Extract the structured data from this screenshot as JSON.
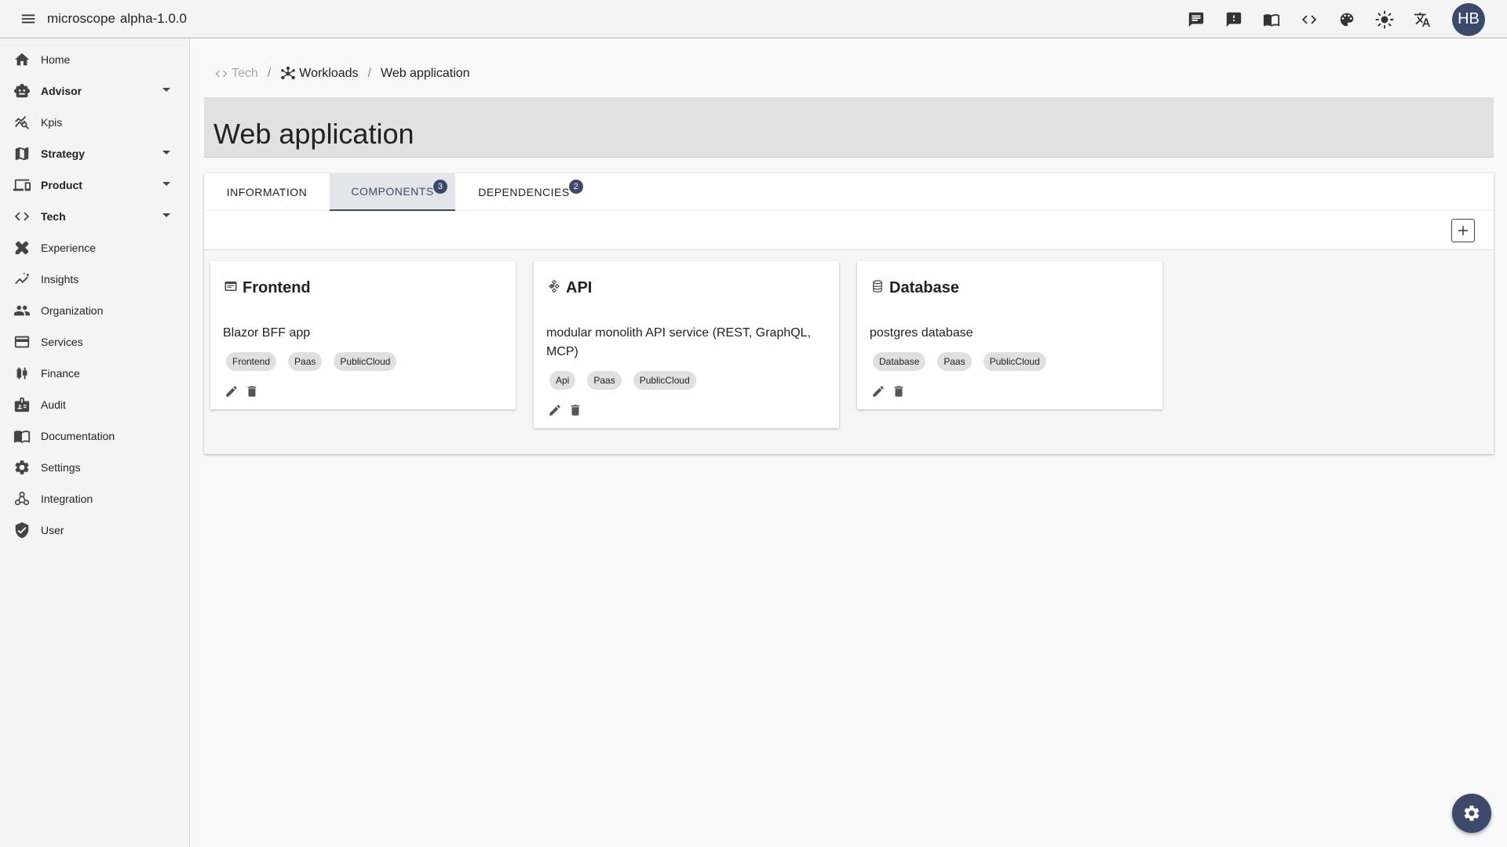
{
  "appbar": {
    "title": "microscope",
    "version": "alpha-1.0.0",
    "avatar_initials": "HB",
    "actions": [
      "chat-icon",
      "feedback-icon",
      "docs-book-icon",
      "code-icon",
      "palette-icon",
      "brightness-icon",
      "translate-icon"
    ]
  },
  "sidebar": {
    "items": [
      {
        "label": "Home",
        "icon": "home-icon",
        "bold": false,
        "expandable": false
      },
      {
        "label": "Advisor",
        "icon": "robot-icon",
        "bold": true,
        "expandable": true
      },
      {
        "label": "Kpis",
        "icon": "query-stats-icon",
        "bold": false,
        "expandable": false
      },
      {
        "label": "Strategy",
        "icon": "map-icon",
        "bold": true,
        "expandable": true
      },
      {
        "label": "Product",
        "icon": "devices-icon",
        "bold": true,
        "expandable": true
      },
      {
        "label": "Tech",
        "icon": "code-icon",
        "bold": true,
        "expandable": true
      },
      {
        "label": "Experience",
        "icon": "design-icon",
        "bold": false,
        "expandable": false
      },
      {
        "label": "Insights",
        "icon": "insights-icon",
        "bold": false,
        "expandable": false
      },
      {
        "label": "Organization",
        "icon": "people-icon",
        "bold": false,
        "expandable": false
      },
      {
        "label": "Services",
        "icon": "card-icon",
        "bold": false,
        "expandable": false
      },
      {
        "label": "Finance",
        "icon": "candlestick-icon",
        "bold": false,
        "expandable": false
      },
      {
        "label": "Audit",
        "icon": "audit-icon",
        "bold": false,
        "expandable": false
      },
      {
        "label": "Documentation",
        "icon": "book-icon",
        "bold": false,
        "expandable": false
      },
      {
        "label": "Settings",
        "icon": "gear-icon",
        "bold": false,
        "expandable": false
      },
      {
        "label": "Integration",
        "icon": "webhook-icon",
        "bold": false,
        "expandable": false
      },
      {
        "label": "User",
        "icon": "shield-icon",
        "bold": false,
        "expandable": false
      }
    ]
  },
  "breadcrumb": {
    "tech": "Tech",
    "workloads": "Workloads",
    "current": "Web application"
  },
  "page": {
    "title": "Web application"
  },
  "tabs": [
    {
      "label": "INFORMATION",
      "badge": null,
      "active": false
    },
    {
      "label": "COMPONENTS",
      "badge": "3",
      "active": true
    },
    {
      "label": "DEPENDENCIES",
      "badge": "2",
      "active": false
    }
  ],
  "cards": [
    {
      "title": "Frontend",
      "icon": "web-window-icon",
      "description": "Blazor BFF app",
      "tags": [
        "Frontend",
        "Paas",
        "PublicCloud"
      ]
    },
    {
      "title": "API",
      "icon": "api-icon",
      "description": "modular monolith API service (REST, GraphQL, MCP)",
      "tags": [
        "Api",
        "Paas",
        "PublicCloud"
      ]
    },
    {
      "title": "Database",
      "icon": "database-icon",
      "description": "postgres database",
      "tags": [
        "Database",
        "Paas",
        "PublicCloud"
      ]
    }
  ],
  "colors": {
    "accent": "#3b4a6b",
    "sidebar_bg": "#f4f4f4",
    "title_bar_bg": "#e1e1e1"
  }
}
